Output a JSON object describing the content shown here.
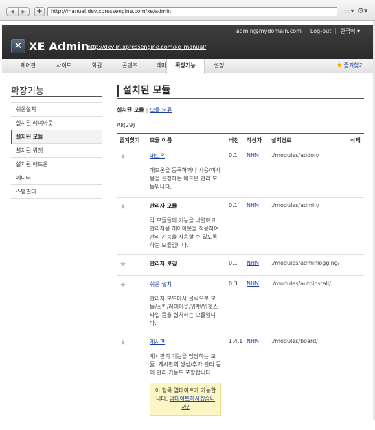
{
  "browser": {
    "url": "http://manual.dev.xpressengine.com/xe/admin",
    "back_glyph": "◀",
    "forward_glyph": "▶",
    "new_tab_glyph": "+",
    "page_menu_glyph": "▭▾",
    "tools_menu_glyph": "⚙▾"
  },
  "header": {
    "user_email": "admin@mydomain.com",
    "logout_label": "Log-out",
    "language_label": "한국어 ▾",
    "logo_mark": "✕",
    "logo_text": "XE Admin",
    "site_url": "http://devlin.xpressengine.com/xe_manual/"
  },
  "tabs": [
    {
      "label": "제어판"
    },
    {
      "label": "사이트"
    },
    {
      "label": "회원"
    },
    {
      "label": "콘텐츠"
    },
    {
      "label": "테마"
    },
    {
      "label": "확장기능",
      "active": true
    },
    {
      "label": "설정"
    }
  ],
  "favorites_label": "즐겨찾기",
  "sidebar": {
    "title": "확장기능",
    "items": [
      {
        "label": "쉬운설치"
      },
      {
        "label": "설치된 레이아웃"
      },
      {
        "label": "설치된 모듈",
        "active": true
      },
      {
        "label": "설치된 위젯"
      },
      {
        "label": "설치된 애드온"
      },
      {
        "label": "에디터"
      },
      {
        "label": "스팸필터"
      }
    ]
  },
  "main": {
    "title": "설치된 모듈",
    "subnav_current": "설치된 모듈",
    "subnav_separator": "|",
    "subnav_link": "모듈 분류",
    "count_label": "All(29)",
    "columns": [
      "즐겨찾기",
      "모듈 이름",
      "버전",
      "작성자",
      "설치경로",
      "삭제"
    ],
    "rows": [
      {
        "name": "애드온",
        "name_is_link": true,
        "description": "애드온을 등록하거나 사용/미사용을 설정하는 애드온 관리 모듈입니다.",
        "version": "0.1",
        "author": "NHN",
        "path": "./modules/addon/"
      },
      {
        "name": "관리자 모듈",
        "name_is_link": false,
        "description": "각 모듈들의 기능을 나열하고 관리자용 레이아웃을 적용하여 관리 기능을 사용할 수 있도록 하는 모듈입니다.",
        "version": "0.1",
        "author": "NHN",
        "path": "./modules/admin/"
      },
      {
        "name": "관리자 로깅",
        "name_is_link": false,
        "description": "",
        "version": "0.1",
        "author": "NHN",
        "path": "./modules/adminlogging/"
      },
      {
        "name": "쉬운 설치",
        "name_is_link": true,
        "description": "관리자 모드에서 클릭으로 모듈/스킨/레이아웃/위젯/위젯스타일 등을 설치하는 모듈입니다.",
        "version": "0.3",
        "author": "NHN",
        "path": "./modules/autoinstall/"
      },
      {
        "name": "게시판",
        "name_is_link": true,
        "description": "게시판의 기능을 담당하는 모듈. 게시판의 생성/추가 관리 등의 관리 기능도 포함합니다.",
        "version": "1.4.1",
        "author": "NHN",
        "path": "./modules/board/",
        "notice_text": "이 항목 업데이트가 가능합니다.",
        "notice_link": "업데이트하시겠습니까?"
      }
    ]
  },
  "colors": {
    "header_bg": "#333333",
    "link": "#1f3fa8",
    "star_fav": "#f0a800",
    "notice_bg": "#fcf6c4"
  }
}
